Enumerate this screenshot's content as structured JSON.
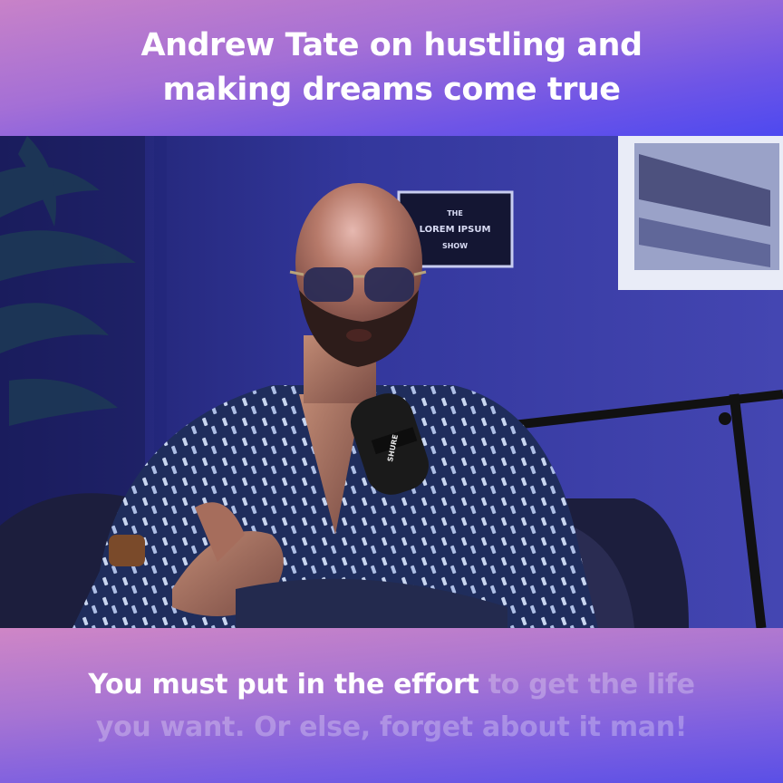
{
  "headline": {
    "line1": "Andrew Tate on hustling and",
    "line2": "making dreams come true"
  },
  "caption": {
    "spoken": "You must put in the effort",
    "upcoming_line1": " to get the life",
    "upcoming_line2": "you want. Or else, forget about it man!"
  },
  "video": {
    "backdrop_sign_top": "THE",
    "backdrop_sign_mid": "LOREM IPSUM",
    "backdrop_sign_bottom": "SHOW",
    "mic_brand": "SHURE"
  },
  "colors": {
    "banner_top_start": "#c882c8",
    "banner_top_end": "#4d49f0",
    "banner_bottom_start": "#cf86c6",
    "banner_bottom_end": "#5a4fe6",
    "room_wall": "#2c2f8e",
    "shirt": "#1f2d5c"
  }
}
